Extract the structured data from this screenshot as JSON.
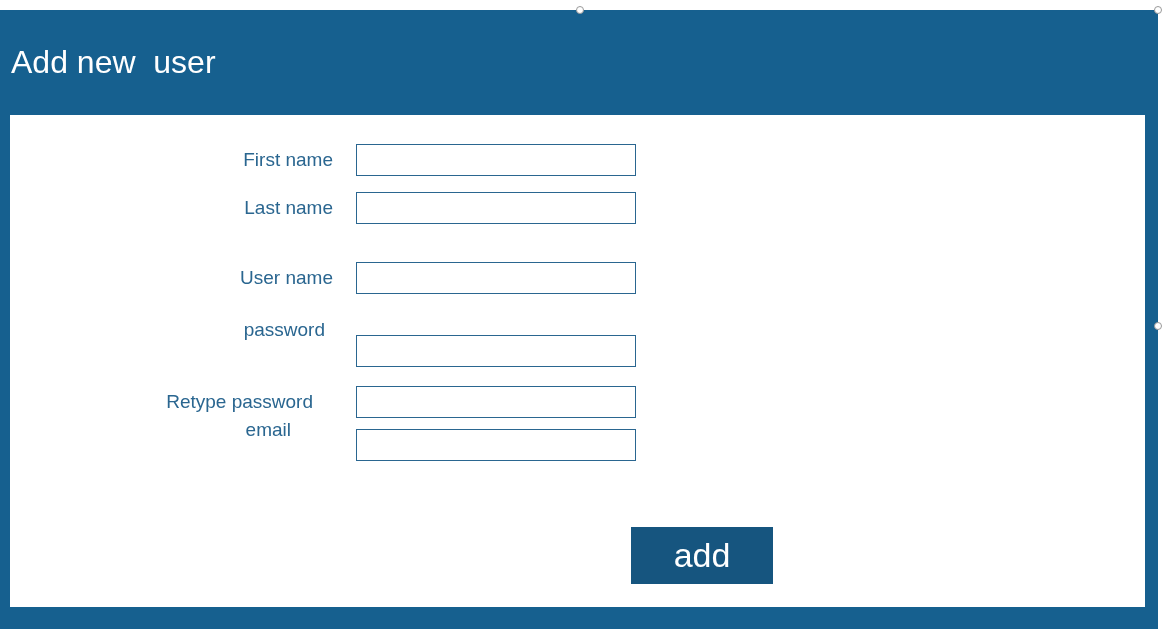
{
  "window": {
    "title": "Add new  user"
  },
  "fields": [
    {
      "label": "First name"
    },
    {
      "label": "Last name"
    },
    {
      "label": "User name"
    },
    {
      "label": "password"
    },
    {
      "label": "Retype password"
    },
    {
      "label": "email"
    }
  ],
  "buttons": [
    "add"
  ]
}
